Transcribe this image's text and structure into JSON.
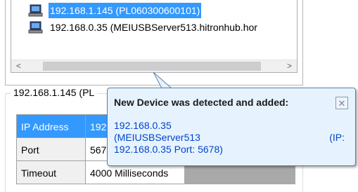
{
  "device_list": {
    "items": [
      {
        "label": "192.168.1.145 (PL060300600101)",
        "selected": true
      },
      {
        "label": "192.168.0.35 (MEIUSBServer513.hitronhub.hor",
        "selected": false
      }
    ],
    "scroll_left": "<",
    "scroll_right": ">"
  },
  "details": {
    "group_title": "192.168.1.145 (PL",
    "rows": [
      {
        "key": "IP Address",
        "value": "192"
      },
      {
        "key": "Port",
        "value": "567"
      },
      {
        "key": "Timeout",
        "value": "4000 Milliseconds"
      }
    ]
  },
  "notification": {
    "title": "New Device was detected and added:",
    "close": "✕",
    "line1": "192.168.0.35",
    "line2": "(MEIUSBServer513",
    "line2_right": "(IP:",
    "line3": "192.168.0.35  Port: 5678)"
  },
  "colors": {
    "selection": "#3399ff",
    "tooltip_bg": "#e6f3ff",
    "tooltip_text": "#0044cc"
  }
}
